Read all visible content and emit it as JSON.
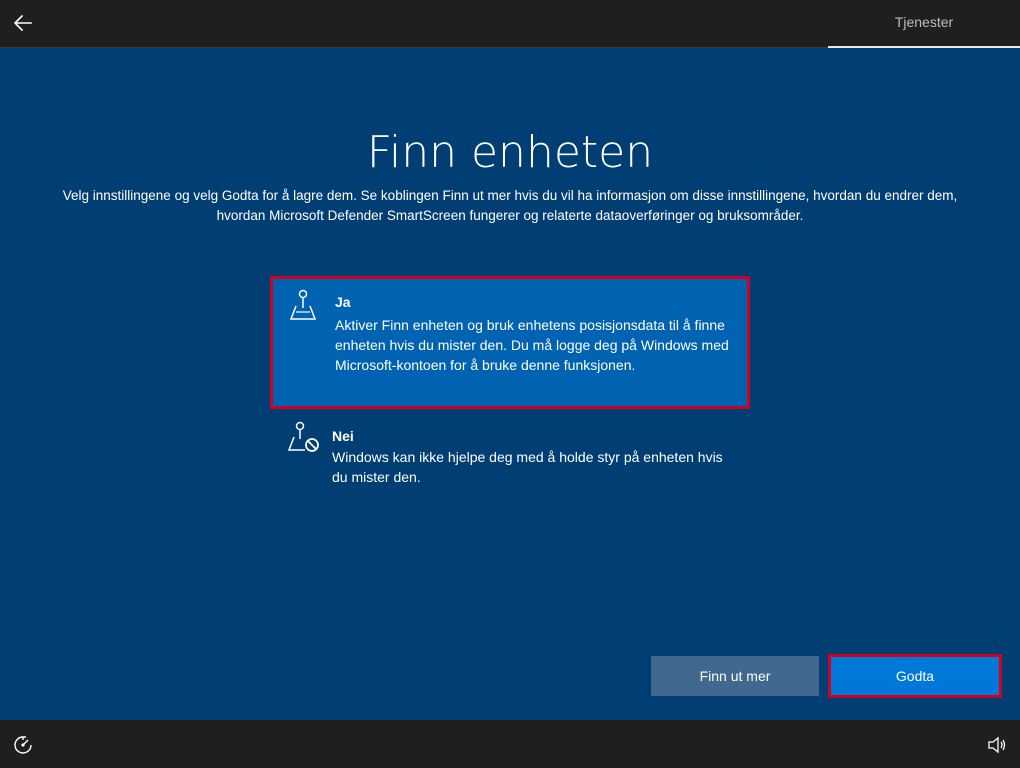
{
  "header": {
    "tab_label": "Tjenester",
    "back_icon": "back-arrow-icon"
  },
  "main": {
    "title": "Finn enheten",
    "subtitle": "Velg innstillingene og velg Godta for å lagre dem. Se koblingen Finn ut mer hvis du vil ha informasjon om disse innstillingene, hvordan du endrer dem, hvordan Microsoft Defender SmartScreen fungerer og relaterte dataoverføringer og bruksområder.",
    "options": [
      {
        "title": "Ja",
        "description": "Aktiver Finn enheten og bruk enhetens posisjonsdata til å finne enheten hvis du mister den. Du må logge deg på Windows med Microsoft-kontoen for å bruke denne funksjonen.",
        "icon": "map-pin-icon",
        "selected": true
      },
      {
        "title": "Nei",
        "description": "Windows kan ikke hjelpe deg med å holde styr på enheten hvis du mister den.",
        "icon": "map-pin-blocked-icon",
        "selected": false
      }
    ]
  },
  "buttons": {
    "learn_more": "Finn ut mer",
    "accept": "Godta"
  },
  "footer": {
    "left_icon": "ease-of-access-icon",
    "right_icon": "volume-icon"
  },
  "colors": {
    "background": "#003e73",
    "selected_option": "#0063b1",
    "accept_button": "#0078d7",
    "learn_more_button": "#41698f",
    "highlight_border": "#d1001f",
    "bars": "#1f1f1f"
  }
}
